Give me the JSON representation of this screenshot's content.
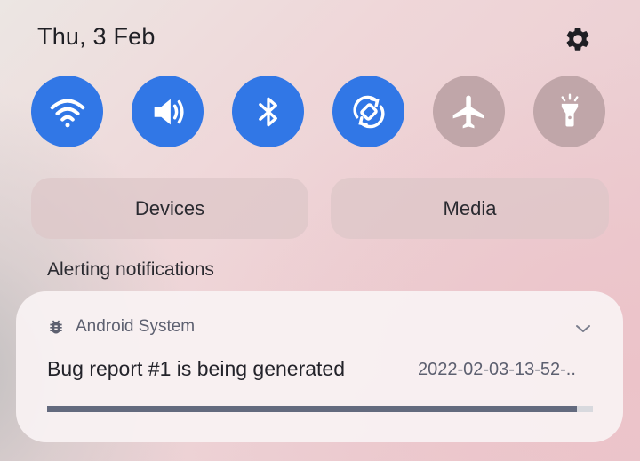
{
  "header": {
    "date": "Thu, 3 Feb"
  },
  "quick_settings": {
    "tiles": [
      {
        "name": "wifi",
        "icon": "wifi-icon",
        "state": "on"
      },
      {
        "name": "sound",
        "icon": "volume-icon",
        "state": "on"
      },
      {
        "name": "bluetooth",
        "icon": "bluetooth-icon",
        "state": "on"
      },
      {
        "name": "auto-rotate",
        "icon": "auto-rotate-icon",
        "state": "on"
      },
      {
        "name": "airplane-mode",
        "icon": "airplane-icon",
        "state": "off"
      },
      {
        "name": "flashlight",
        "icon": "flashlight-icon",
        "state": "off"
      }
    ],
    "colors": {
      "active": "#3177e6",
      "inactive": "#c0a6a9"
    }
  },
  "buttons": {
    "devices_label": "Devices",
    "media_label": "Media"
  },
  "section": {
    "alerting_label": "Alerting notifications"
  },
  "notification": {
    "app_icon": "bug-icon",
    "app_name": "Android System",
    "title": "Bug report #1 is being generated",
    "meta": "2022-02-03-13-52-..",
    "progress": 0.97
  }
}
